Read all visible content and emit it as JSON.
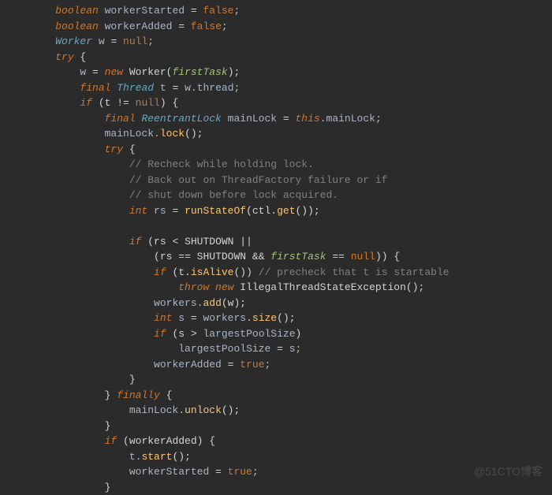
{
  "code": {
    "lines": [
      {
        "indent": 9,
        "tokens": [
          [
            "kw",
            "boolean"
          ],
          [
            "var",
            " workerStarted "
          ],
          [
            "op",
            "= "
          ],
          [
            "bool",
            "false"
          ],
          [
            "punc",
            ";"
          ]
        ]
      },
      {
        "indent": 9,
        "tokens": [
          [
            "kw",
            "boolean"
          ],
          [
            "var",
            " workerAdded "
          ],
          [
            "op",
            "= "
          ],
          [
            "bool",
            "false"
          ],
          [
            "punc",
            ";"
          ]
        ]
      },
      {
        "indent": 9,
        "tokens": [
          [
            "type",
            "Worker"
          ],
          [
            "var",
            " w "
          ],
          [
            "op",
            "= "
          ],
          [
            "bool",
            "null"
          ],
          [
            "punc",
            ";"
          ]
        ]
      },
      {
        "indent": 9,
        "tokens": [
          [
            "kw",
            "try"
          ],
          [
            "white",
            " {"
          ]
        ]
      },
      {
        "indent": 13,
        "tokens": [
          [
            "var",
            "w "
          ],
          [
            "op",
            "= "
          ],
          [
            "kw",
            "new"
          ],
          [
            "white",
            " Worker("
          ],
          [
            "param",
            "firstTask"
          ],
          [
            "white",
            ");"
          ]
        ]
      },
      {
        "indent": 13,
        "tokens": [
          [
            "kw",
            "final"
          ],
          [
            "type",
            " Thread"
          ],
          [
            "var",
            " t "
          ],
          [
            "op",
            "= "
          ],
          [
            "var",
            "w"
          ],
          [
            "punc",
            "."
          ],
          [
            "var",
            "thread"
          ],
          [
            "punc",
            ";"
          ]
        ]
      },
      {
        "indent": 13,
        "tokens": [
          [
            "kw",
            "if"
          ],
          [
            "white",
            " (t "
          ],
          [
            "op",
            "!= "
          ],
          [
            "bool",
            "null"
          ],
          [
            "white",
            ") {"
          ]
        ]
      },
      {
        "indent": 17,
        "tokens": [
          [
            "kw",
            "final"
          ],
          [
            "type",
            " ReentrantLock"
          ],
          [
            "var",
            " mainLock "
          ],
          [
            "op",
            "= "
          ],
          [
            "kw",
            "this"
          ],
          [
            "punc",
            "."
          ],
          [
            "var",
            "mainLock"
          ],
          [
            "punc",
            ";"
          ]
        ]
      },
      {
        "indent": 17,
        "tokens": [
          [
            "var",
            "mainLock"
          ],
          [
            "punc",
            "."
          ],
          [
            "method",
            "lock"
          ],
          [
            "white",
            "();"
          ]
        ]
      },
      {
        "indent": 17,
        "tokens": [
          [
            "kw",
            "try"
          ],
          [
            "white",
            " {"
          ]
        ]
      },
      {
        "indent": 21,
        "tokens": [
          [
            "comment",
            "// Recheck while holding lock."
          ]
        ]
      },
      {
        "indent": 21,
        "tokens": [
          [
            "comment",
            "// Back out on ThreadFactory failure or if"
          ]
        ]
      },
      {
        "indent": 21,
        "tokens": [
          [
            "comment",
            "// shut down before lock acquired."
          ]
        ]
      },
      {
        "indent": 21,
        "tokens": [
          [
            "kw",
            "int"
          ],
          [
            "var",
            " rs "
          ],
          [
            "op",
            "= "
          ],
          [
            "method",
            "runStateOf"
          ],
          [
            "white",
            "(ctl."
          ],
          [
            "method",
            "get"
          ],
          [
            "white",
            "());"
          ]
        ]
      },
      {
        "indent": 0,
        "tokens": []
      },
      {
        "indent": 21,
        "tokens": [
          [
            "kw",
            "if"
          ],
          [
            "white",
            " (rs "
          ],
          [
            "op",
            "<"
          ],
          [
            "white",
            " SHUTDOWN "
          ],
          [
            "op",
            "||"
          ]
        ]
      },
      {
        "indent": 25,
        "tokens": [
          [
            "white",
            "(rs "
          ],
          [
            "op",
            "=="
          ],
          [
            "white",
            " SHUTDOWN "
          ],
          [
            "op",
            "&&"
          ],
          [
            "param",
            " firstTask "
          ],
          [
            "op",
            "== "
          ],
          [
            "bool",
            "null"
          ],
          [
            "white",
            ")) {"
          ]
        ]
      },
      {
        "indent": 25,
        "tokens": [
          [
            "kw",
            "if"
          ],
          [
            "white",
            " (t."
          ],
          [
            "method",
            "isAlive"
          ],
          [
            "white",
            "()) "
          ],
          [
            "comment",
            "// precheck that t is startable"
          ]
        ]
      },
      {
        "indent": 29,
        "tokens": [
          [
            "kw",
            "throw new"
          ],
          [
            "white",
            " IllegalThreadStateException();"
          ]
        ]
      },
      {
        "indent": 25,
        "tokens": [
          [
            "var",
            "workers"
          ],
          [
            "punc",
            "."
          ],
          [
            "method",
            "add"
          ],
          [
            "white",
            "(w);"
          ]
        ]
      },
      {
        "indent": 25,
        "tokens": [
          [
            "kw",
            "int"
          ],
          [
            "var",
            " s "
          ],
          [
            "op",
            "= "
          ],
          [
            "var",
            "workers"
          ],
          [
            "punc",
            "."
          ],
          [
            "method",
            "size"
          ],
          [
            "white",
            "();"
          ]
        ]
      },
      {
        "indent": 25,
        "tokens": [
          [
            "kw",
            "if"
          ],
          [
            "white",
            " (s "
          ],
          [
            "op",
            ">"
          ],
          [
            "var",
            " largestPoolSize"
          ],
          [
            "white",
            ")"
          ]
        ]
      },
      {
        "indent": 29,
        "tokens": [
          [
            "var",
            "largestPoolSize "
          ],
          [
            "op",
            "= "
          ],
          [
            "var",
            "s"
          ],
          [
            "punc",
            ";"
          ]
        ]
      },
      {
        "indent": 25,
        "tokens": [
          [
            "var",
            "workerAdded "
          ],
          [
            "op",
            "= "
          ],
          [
            "bool",
            "true"
          ],
          [
            "punc",
            ";"
          ]
        ]
      },
      {
        "indent": 21,
        "tokens": [
          [
            "white",
            "}"
          ]
        ]
      },
      {
        "indent": 17,
        "tokens": [
          [
            "white",
            "} "
          ],
          [
            "kw",
            "finally"
          ],
          [
            "white",
            " {"
          ]
        ]
      },
      {
        "indent": 21,
        "tokens": [
          [
            "var",
            "mainLock"
          ],
          [
            "punc",
            "."
          ],
          [
            "method",
            "unlock"
          ],
          [
            "white",
            "();"
          ]
        ]
      },
      {
        "indent": 17,
        "tokens": [
          [
            "white",
            "}"
          ]
        ]
      },
      {
        "indent": 17,
        "tokens": [
          [
            "kw",
            "if"
          ],
          [
            "white",
            " (workerAdded) {"
          ]
        ]
      },
      {
        "indent": 21,
        "tokens": [
          [
            "var",
            "t"
          ],
          [
            "punc",
            "."
          ],
          [
            "method",
            "start"
          ],
          [
            "white",
            "();"
          ]
        ]
      },
      {
        "indent": 21,
        "tokens": [
          [
            "var",
            "workerStarted "
          ],
          [
            "op",
            "= "
          ],
          [
            "bool",
            "true"
          ],
          [
            "punc",
            ";"
          ]
        ]
      },
      {
        "indent": 17,
        "tokens": [
          [
            "white",
            "}"
          ]
        ]
      }
    ]
  },
  "watermark": "@51CTO博客"
}
